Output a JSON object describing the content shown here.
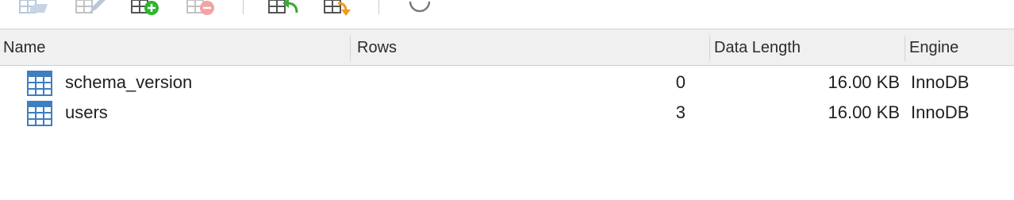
{
  "toolbar": {
    "buttons": [
      {
        "icon": "open-table-icon"
      },
      {
        "icon": "edit-table-icon"
      },
      {
        "icon": "add-table-icon"
      },
      {
        "icon": "remove-table-icon"
      },
      {
        "icon": "import-table-icon"
      },
      {
        "icon": "export-table-icon"
      },
      {
        "icon": "refresh-icon"
      }
    ]
  },
  "table": {
    "columns": {
      "name": "Name",
      "rows": "Rows",
      "data_length": "Data Length",
      "engine": "Engine"
    },
    "rows": [
      {
        "name": "schema_version",
        "rows": "0",
        "data_length": "16.00 KB",
        "engine": "InnoDB",
        "icon": "table-icon"
      },
      {
        "name": "users",
        "rows": "3",
        "data_length": "16.00 KB",
        "engine": "InnoDB",
        "icon": "table-icon"
      }
    ]
  },
  "colors": {
    "header_bg": "#f0f0f0",
    "table_icon": "#3d7fc1",
    "add_green": "#2fb52f",
    "remove_red": "#e06666",
    "import_green": "#3aa935",
    "export_orange": "#f19a1a"
  }
}
